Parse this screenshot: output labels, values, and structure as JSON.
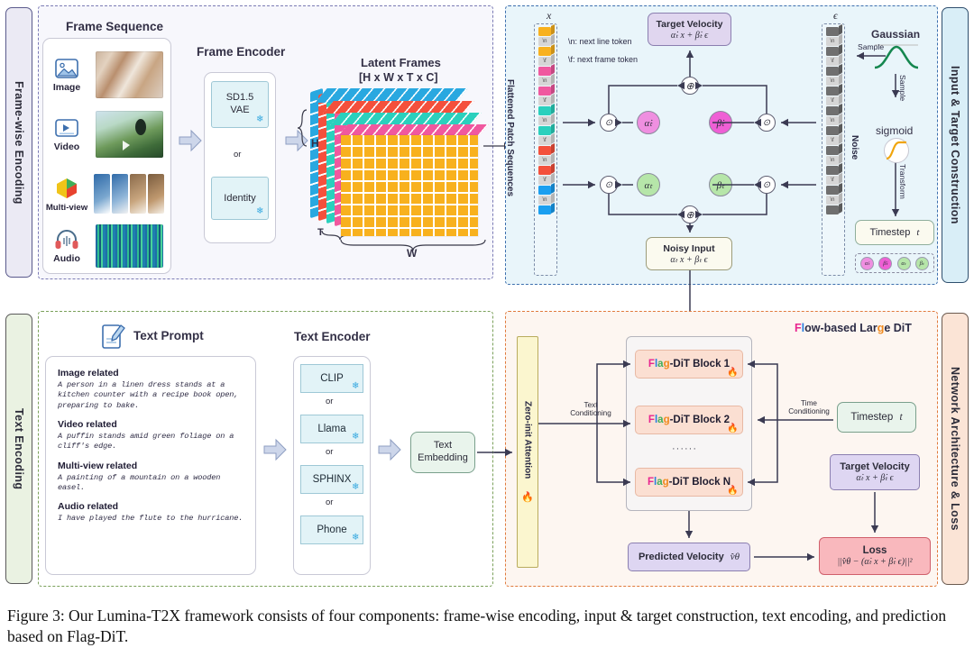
{
  "figure": {
    "caption": "Figure 3: Our Lumina-T2X framework consists of four components: frame-wise encoding, input & target construction, text encoding, and prediction based on Flag-DiT."
  },
  "panel_frame_encoding": {
    "side_label": "Frame-wise Encoding",
    "side_label_bg": "#ebeaf4",
    "border_color": "#7b7bb5",
    "frame_sequence_title": "Frame Sequence",
    "modalities": [
      {
        "label": "Image",
        "icon": "image-icon"
      },
      {
        "label": "Video",
        "icon": "video-icon"
      },
      {
        "label": "Multi-view",
        "icon": "cube-icon"
      },
      {
        "label": "Audio",
        "icon": "headphones-icon"
      }
    ],
    "frame_encoder_title": "Frame Encoder",
    "encoder_options": [
      {
        "label": "SD1.5\nVAE",
        "line1": "SD1.5",
        "line2": "VAE",
        "frozen": true
      },
      {
        "label": "Identity",
        "line1": "Identity",
        "line2": "",
        "frozen": true
      }
    ],
    "or_label": "or",
    "latent_title": "Latent Frames",
    "latent_subtitle": "[H x W x T x C]",
    "axis_h": "H",
    "axis_w": "W",
    "axis_t": "T",
    "cube_layer_colors": [
      "#29a8e0",
      "#f4503c",
      "#2ad0bd",
      "#f0589f",
      "#f8b11e"
    ]
  },
  "panel_input_target": {
    "side_label": "Input & Target Construction",
    "side_label_bg": "#d9eef7",
    "border_color": "#3d6fae",
    "panel_bg": "#e9f5fa",
    "sequence_label": "Flattened Patch Sequences",
    "sequence_symbol": "x",
    "noise_symbol": "ϵ",
    "noise_label": "Noise",
    "legend": [
      "\\n: next line token",
      "\\f: next frame token"
    ],
    "token_colors": [
      "#f8b11e",
      "#f0589f",
      "#2ad0bd",
      "#f4503c",
      "#1a9ff0"
    ],
    "token_separators": [
      "\\n",
      "\\f"
    ],
    "target_velocity": {
      "title": "Target Velocity",
      "formula": "α̇ₜ x + β̇ₜ ϵ",
      "bg": "#e0d6ef"
    },
    "noisy_input": {
      "title": "Noisy Input",
      "formula": "αₜ x + βₜ ϵ",
      "bg": "#fbfaef"
    },
    "coefficients": [
      {
        "symbol": "α̇ₜ",
        "color": "#ef8fe0",
        "row": "top"
      },
      {
        "symbol": "β̇ₜ",
        "color": "#ef5fd5",
        "row": "top"
      },
      {
        "symbol": "αₜ",
        "color": "#b6e6a9",
        "row": "bottom"
      },
      {
        "symbol": "βₜ",
        "color": "#b6e6a9",
        "row": "bottom"
      }
    ],
    "legend_chips": [
      "α̇ₜ",
      "β̇ₜ",
      "αₜ",
      "βₜ"
    ],
    "gaussian_title": "Gaussian",
    "sigmoid_title": "sigmoid",
    "sample_label_1": "Sample",
    "sample_label_2": "Sample",
    "transform_label": "Transform",
    "timestep": {
      "label": "Timestep",
      "symbol": "t",
      "bg": "#fbfaef"
    },
    "mul_symbol": "⊙",
    "add_symbol": "⊕"
  },
  "panel_text_encoding": {
    "side_label": "Text Encoding",
    "side_label_bg": "#eaf2e2",
    "border_color": "#7aa05a",
    "text_prompt_title": "Text Prompt",
    "text_encoder_title": "Text Encoder",
    "pencil_icon": "pencil-note-icon",
    "prompts": [
      {
        "head": "Image related",
        "body": "A person in a linen dress stands at a kitchen counter with a recipe book open, preparing to bake."
      },
      {
        "head": "Video related",
        "body": "A puffin stands amid green foliage on a cliff's edge."
      },
      {
        "head": "Multi-view related",
        "body": "A painting of a mountain on a wooden easel."
      },
      {
        "head": "Audio related",
        "body": "I have played the flute to the hurricane."
      }
    ],
    "encoders": [
      "CLIP",
      "Llama",
      "SPHINX",
      "Phone"
    ],
    "or_label": "or",
    "text_embedding": {
      "line1": "Text",
      "line2": "Embedding",
      "bg": "#e9f4ec"
    }
  },
  "panel_network": {
    "side_label": "Network Architecture & Loss",
    "side_label_bg": "#fbe4d6",
    "border_color": "#e07a3c",
    "panel_bg": "#fdf6f1",
    "title_parts": [
      {
        "t": "F",
        "c": "#e8268f"
      },
      {
        "t": "l",
        "c": "#2a7fe0"
      },
      {
        "t": "ow-based Lar",
        "c": "#2b2b45"
      },
      {
        "t": "g",
        "c": "#f08a1e"
      },
      {
        "t": "e DiT",
        "c": "#2b2b45"
      }
    ],
    "zero_init_attention": {
      "label": "Zero-init Attention",
      "bg": "#fbf6cf",
      "flame": true
    },
    "dit_blocks": [
      {
        "prefix_parts": [
          {
            "t": "F",
            "c": "#e8268f"
          },
          {
            "t": "l",
            "c": "#2a7fe0"
          },
          {
            "t": "a",
            "c": "#3fae5a"
          },
          {
            "t": "g",
            "c": "#f08a1e"
          }
        ],
        "suffix": "-DiT Block 1"
      },
      {
        "prefix_parts": [
          {
            "t": "F",
            "c": "#e8268f"
          },
          {
            "t": "l",
            "c": "#2a7fe0"
          },
          {
            "t": "a",
            "c": "#3fae5a"
          },
          {
            "t": "g",
            "c": "#f08a1e"
          }
        ],
        "suffix": "-DiT Block 2"
      },
      {
        "prefix_parts": [
          {
            "t": "F",
            "c": "#e8268f"
          },
          {
            "t": "l",
            "c": "#2a7fe0"
          },
          {
            "t": "a",
            "c": "#3fae5a"
          },
          {
            "t": "g",
            "c": "#f08a1e"
          }
        ],
        "suffix": "-DiT Block N"
      }
    ],
    "ellipsis": "······",
    "text_conditioning_label": "Text\nConditioning",
    "text_conditioning_l1": "Text",
    "text_conditioning_l2": "Conditioning",
    "time_conditioning_l1": "Time",
    "time_conditioning_l2": "Conditioning",
    "timestep": {
      "label": "Timestep",
      "symbol": "t",
      "bg": "#e9f4ec"
    },
    "target_velocity": {
      "title": "Target Velocity",
      "formula": "α̇ₜ x + β̇ₜ ϵ",
      "bg": "#ded6f2"
    },
    "predicted_velocity": {
      "title": "Predicted Velocity",
      "symbol": "v̂θ",
      "bg": "#ded6f2"
    },
    "loss": {
      "title": "Loss",
      "formula": "||v̂θ − (α̇ₜ x + β̇ₜ ϵ)||²",
      "bg": "#f9b8bd"
    }
  }
}
